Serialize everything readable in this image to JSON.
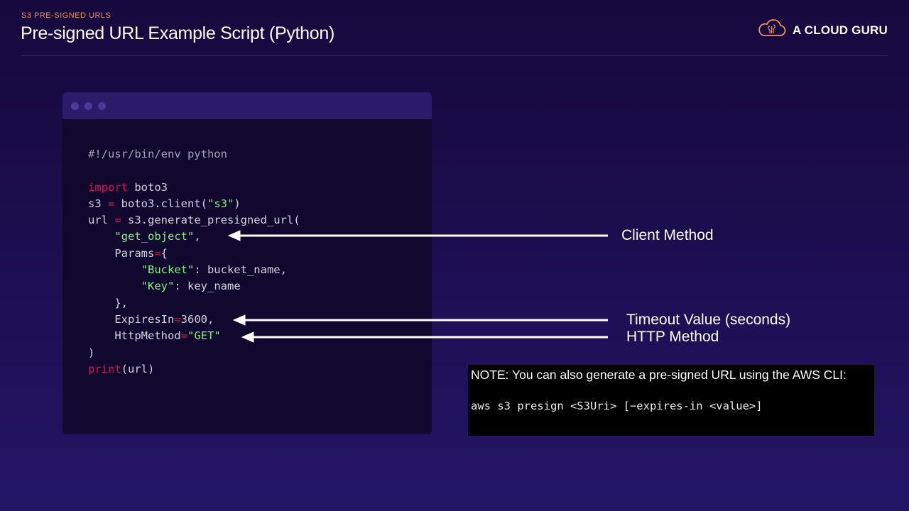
{
  "slide": {
    "eyebrow": "S3 PRE-SIGNED URLS",
    "title": "Pre-signed URL Example Script (Python)",
    "logo_text": "A CLOUD GURU",
    "logo_icon": "cloud-brain-icon"
  },
  "code_window": {
    "lines": [
      [
        {
          "t": "#!/usr/bin/env python",
          "c": "comment"
        }
      ],
      [],
      [
        {
          "t": "import",
          "c": "kw"
        },
        {
          "t": " boto3",
          "c": ""
        }
      ],
      [
        {
          "t": "s3 ",
          "c": ""
        },
        {
          "t": "=",
          "c": "op"
        },
        {
          "t": " boto3.client(",
          "c": ""
        },
        {
          "t": "\"s3\"",
          "c": "str"
        },
        {
          "t": ")",
          "c": ""
        }
      ],
      [
        {
          "t": "url ",
          "c": ""
        },
        {
          "t": "=",
          "c": "op"
        },
        {
          "t": " s3.generate_presigned_url(",
          "c": ""
        }
      ],
      [
        {
          "t": "    ",
          "c": ""
        },
        {
          "t": "\"get_object\"",
          "c": "str"
        },
        {
          "t": ",",
          "c": ""
        }
      ],
      [
        {
          "t": "    Params",
          "c": ""
        },
        {
          "t": "=",
          "c": "op"
        },
        {
          "t": "{",
          "c": ""
        }
      ],
      [
        {
          "t": "        ",
          "c": ""
        },
        {
          "t": "\"Bucket\"",
          "c": "str"
        },
        {
          "t": ": bucket_name,",
          "c": ""
        }
      ],
      [
        {
          "t": "        ",
          "c": ""
        },
        {
          "t": "\"Key\"",
          "c": "str"
        },
        {
          "t": ": key_name",
          "c": ""
        }
      ],
      [
        {
          "t": "    },",
          "c": ""
        }
      ],
      [
        {
          "t": "    ExpiresIn",
          "c": ""
        },
        {
          "t": "=",
          "c": "op"
        },
        {
          "t": "3600,",
          "c": ""
        }
      ],
      [
        {
          "t": "    HttpMethod",
          "c": ""
        },
        {
          "t": "=",
          "c": "op"
        },
        {
          "t": "\"GET\"",
          "c": "str"
        }
      ],
      [
        {
          "t": ")",
          "c": ""
        }
      ],
      [
        {
          "t": "print",
          "c": "kw"
        },
        {
          "t": "(url)",
          "c": ""
        }
      ]
    ]
  },
  "callouts": {
    "client_method": "Client Method",
    "timeout": "Timeout Value (seconds)",
    "http_method": "HTTP Method"
  },
  "note": {
    "text": "NOTE: You can also generate a pre-signed URL using the AWS CLI:",
    "command": "aws s3 presign <S3Uri> [−expires-in <value>]"
  },
  "colors": {
    "eyebrow": "#f28f5c",
    "keyword": "#d6124f",
    "string": "#7ff07c",
    "logo": "#f28f5c"
  }
}
